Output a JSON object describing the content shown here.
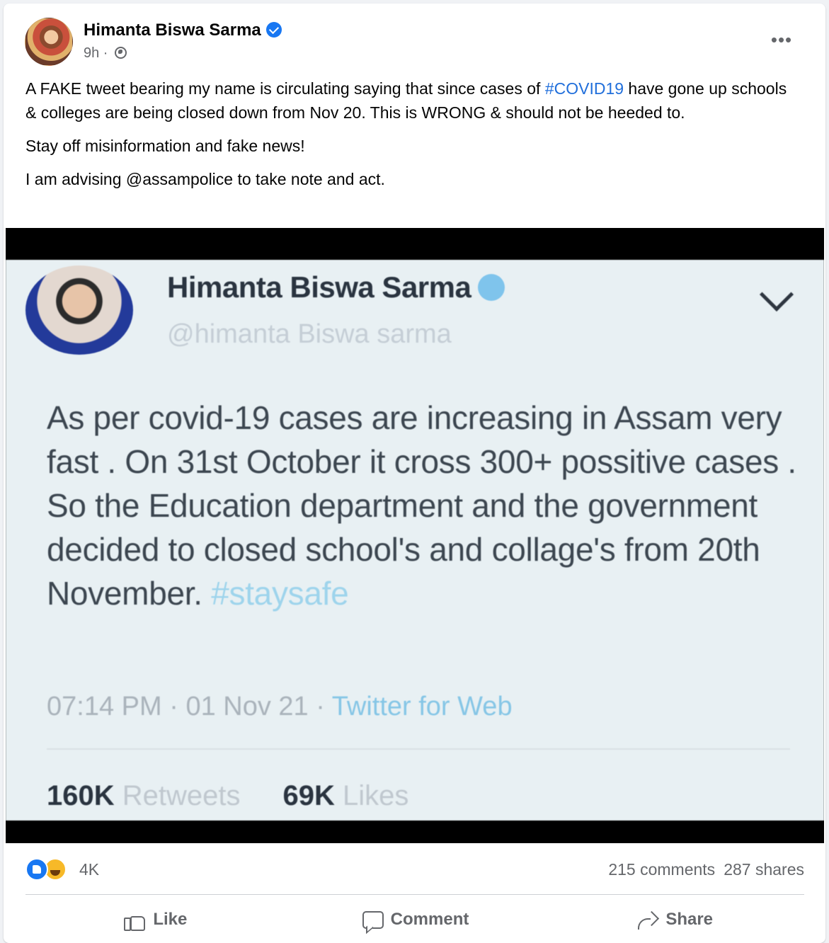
{
  "post": {
    "author": "Himanta Biswa Sarma",
    "time": "9h",
    "meta_separator": " · ",
    "more_label": "•••",
    "text": {
      "p1_before": "A FAKE tweet bearing my name is circulating saying that since cases of ",
      "p1_hashtag": "#COVID19",
      "p1_after": " have gone up schools & colleges are being closed down from Nov 20. This is WRONG & should not be heeded to.",
      "p2": "Stay off misinformation and fake news!",
      "p3": "I am advising @assampolice to take note and act."
    },
    "colors": {
      "link": "#216fdb",
      "verified": "#1877f2",
      "secondary_text": "#65676b"
    }
  },
  "tweet_image": {
    "name": "Himanta Biswa Sarma",
    "handle": "@himanta Biswa sarma",
    "body": "As per covid-19 cases are increasing in Assam very fast . On 31st October it cross 300+ possitive cases . So the Education department and the government decided to closed school's and collage's from 20th November.",
    "hashtag": "#staysafe",
    "time": "07:14 PM",
    "date": "01 Nov 21",
    "source": "Twitter for Web",
    "retweets_count": "160K",
    "retweets_label": "Retweets",
    "likes_count": "69K",
    "likes_label": "Likes"
  },
  "engagement": {
    "reactions_count": "4K",
    "reaction_icons": [
      "like-reaction-icon",
      "haha-reaction-icon"
    ],
    "comments": "215 comments",
    "shares": "287 shares"
  },
  "actions": {
    "like": "Like",
    "comment": "Comment",
    "share": "Share"
  }
}
